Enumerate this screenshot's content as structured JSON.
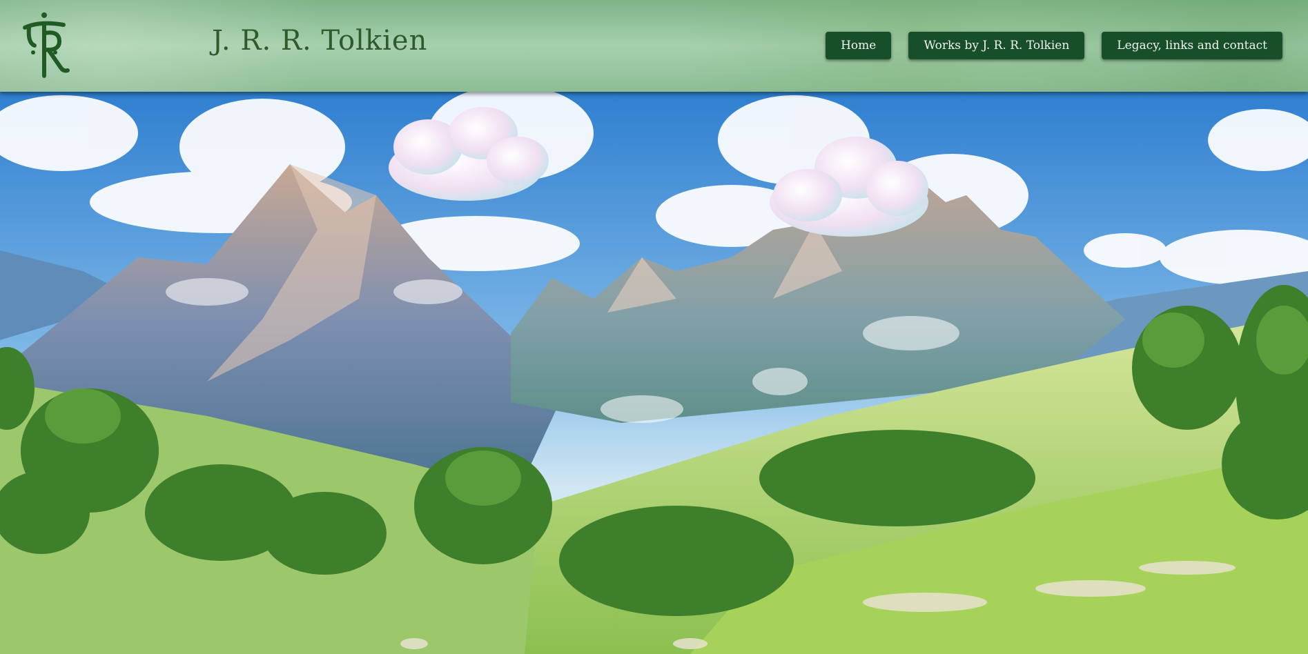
{
  "header": {
    "logo_alt": "JRRT monogram",
    "title": "J. R. R. Tolkien"
  },
  "nav": {
    "items": [
      {
        "label": "Home"
      },
      {
        "label": "Works by J. R. R. Tolkien"
      },
      {
        "label": "Legacy, links and contact"
      }
    ]
  },
  "colors": {
    "nav_button_bg": "#174f2a",
    "header_bg": "#9ccaa3",
    "title_color": "#2f5a2a"
  },
  "hero": {
    "image_subject": "anime-style mountain valley landscape with clouds"
  }
}
